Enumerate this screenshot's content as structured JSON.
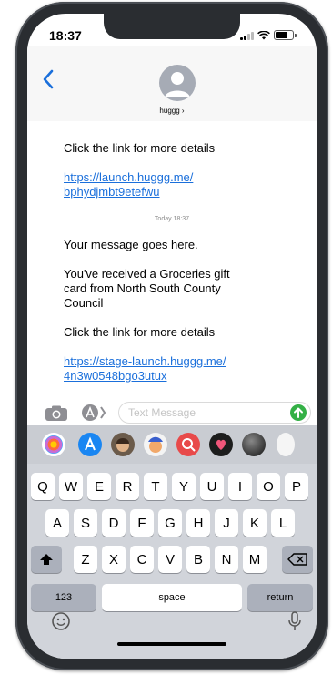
{
  "status": {
    "time": "18:37"
  },
  "contact": {
    "name": "huggg ›"
  },
  "messages": {
    "first_text": "Click the link for more details",
    "first_link": "https://launch.huggg.me/ bphydjmbt9etefwu",
    "timestamp": "Today 18:37",
    "second_line1": "Your message goes here.",
    "second_line2": "You've received a Groceries gift card from North South County Council",
    "second_line3": "Click the link for more details",
    "second_link": "https://stage-launch.huggg.me/ 4n3w0548bgo3utux"
  },
  "compose": {
    "placeholder": "Text Message"
  },
  "keyboard": {
    "row1": [
      "Q",
      "W",
      "E",
      "R",
      "T",
      "Y",
      "U",
      "I",
      "O",
      "P"
    ],
    "row2": [
      "A",
      "S",
      "D",
      "F",
      "G",
      "H",
      "J",
      "K",
      "L"
    ],
    "row3": [
      "Z",
      "X",
      "C",
      "V",
      "B",
      "N",
      "M"
    ],
    "numbers_key": "123",
    "space_key": "space",
    "return_key": "return"
  },
  "colors": {
    "link": "#1a6fdb",
    "send_button": "#34b046",
    "keyboard_bg": "#d1d4da"
  },
  "app_icons": [
    "photos-icon",
    "app-store-icon",
    "memoji-icon",
    "animoji-icon",
    "image-search-icon",
    "digital-touch-icon",
    "music-icon",
    "more-app-icon"
  ]
}
